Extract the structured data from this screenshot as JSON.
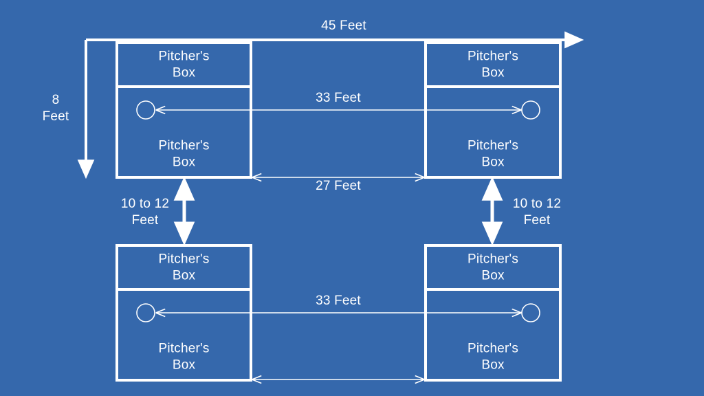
{
  "diagram": {
    "title": "Horseshoe pitching court dimensions diagram",
    "background_color": "#3568ac",
    "line_color": "#ffffff",
    "text_color": "#ffffff",
    "courts": [
      {
        "id": "top-left",
        "pitchers_box_top_label": "Pitcher's\nBox",
        "pitchers_box_bottom_label": "Pitcher's\nBox",
        "stake": "stake-circle"
      },
      {
        "id": "top-right",
        "pitchers_box_top_label": "Pitcher's\nBox",
        "pitchers_box_bottom_label": "Pitcher's\nBox",
        "stake": "stake-circle"
      },
      {
        "id": "bottom-left",
        "pitchers_box_top_label": "Pitcher's\nBox",
        "pitchers_box_bottom_label": "Pitcher's\nBox",
        "stake": "stake-circle"
      },
      {
        "id": "bottom-right",
        "pitchers_box_top_label": "Pitcher's\nBox",
        "pitchers_box_bottom_label": "Pitcher's\nBox",
        "stake": "stake-circle"
      }
    ],
    "dimensions": {
      "overall_width": "45 Feet",
      "court_depth": "8\nFeet",
      "stake_to_stake_top": "33 Feet",
      "stake_to_stake_bottom": "33 Feet",
      "platform_gap": "27 Feet",
      "court_spacing_left": "10 to 12\nFeet",
      "court_spacing_right": "10 to 12\nFeet"
    }
  }
}
